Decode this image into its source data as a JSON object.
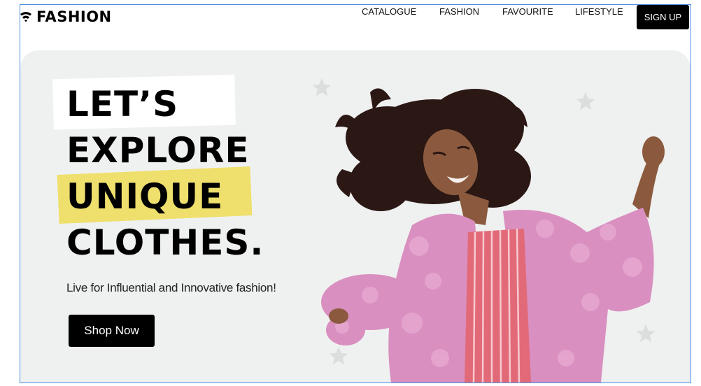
{
  "header": {
    "logo_text": "FASHION",
    "logo_icon": "wifi-icon",
    "nav": [
      {
        "label": "CATALOGUE"
      },
      {
        "label": "FASHION"
      },
      {
        "label": "FAVOURITE"
      },
      {
        "label": "LIFESTYLE"
      }
    ],
    "signup_label": "SIGN UP"
  },
  "hero": {
    "headline": [
      "LET’S",
      "EXPLORE",
      "UNIQUE",
      "CLOTHES."
    ],
    "tagline": "Live for Influential and Innovative fashion!",
    "cta_label": "Shop Now",
    "decoration_icon": "star-icon",
    "photo_subject": "woman-in-pink-fur-coat"
  },
  "colors": {
    "hero_bg": "#eff1f0",
    "highlight_yellow": "#efdf6d",
    "button_bg": "#000000",
    "coat_pink": "#d98fc0",
    "top_stripe": "#e26a78"
  }
}
